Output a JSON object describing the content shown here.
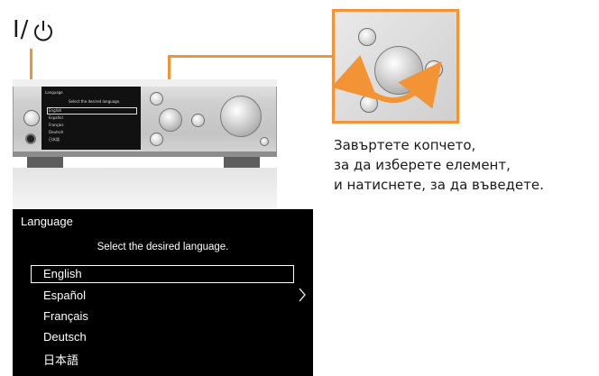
{
  "power_label": "I/",
  "power_icon": "power-standby-icon",
  "accent_color": "#f29435",
  "device": {
    "mini_screen_lines": [
      "Language",
      "Select the desired language.",
      "English",
      "Español",
      "Français",
      "Deutsch",
      "日本語"
    ]
  },
  "caption": {
    "lines": [
      "Завъртете копчето,",
      "за да изберете елемент,",
      "и натиснете, за да въведете."
    ]
  },
  "language_screen": {
    "title": "Language",
    "prompt": "Select the desired language.",
    "options": [
      "English",
      "Español",
      "Français",
      "Deutsch",
      "日本語"
    ],
    "selected": "English",
    "more_icon": "chevron-right-icon"
  }
}
